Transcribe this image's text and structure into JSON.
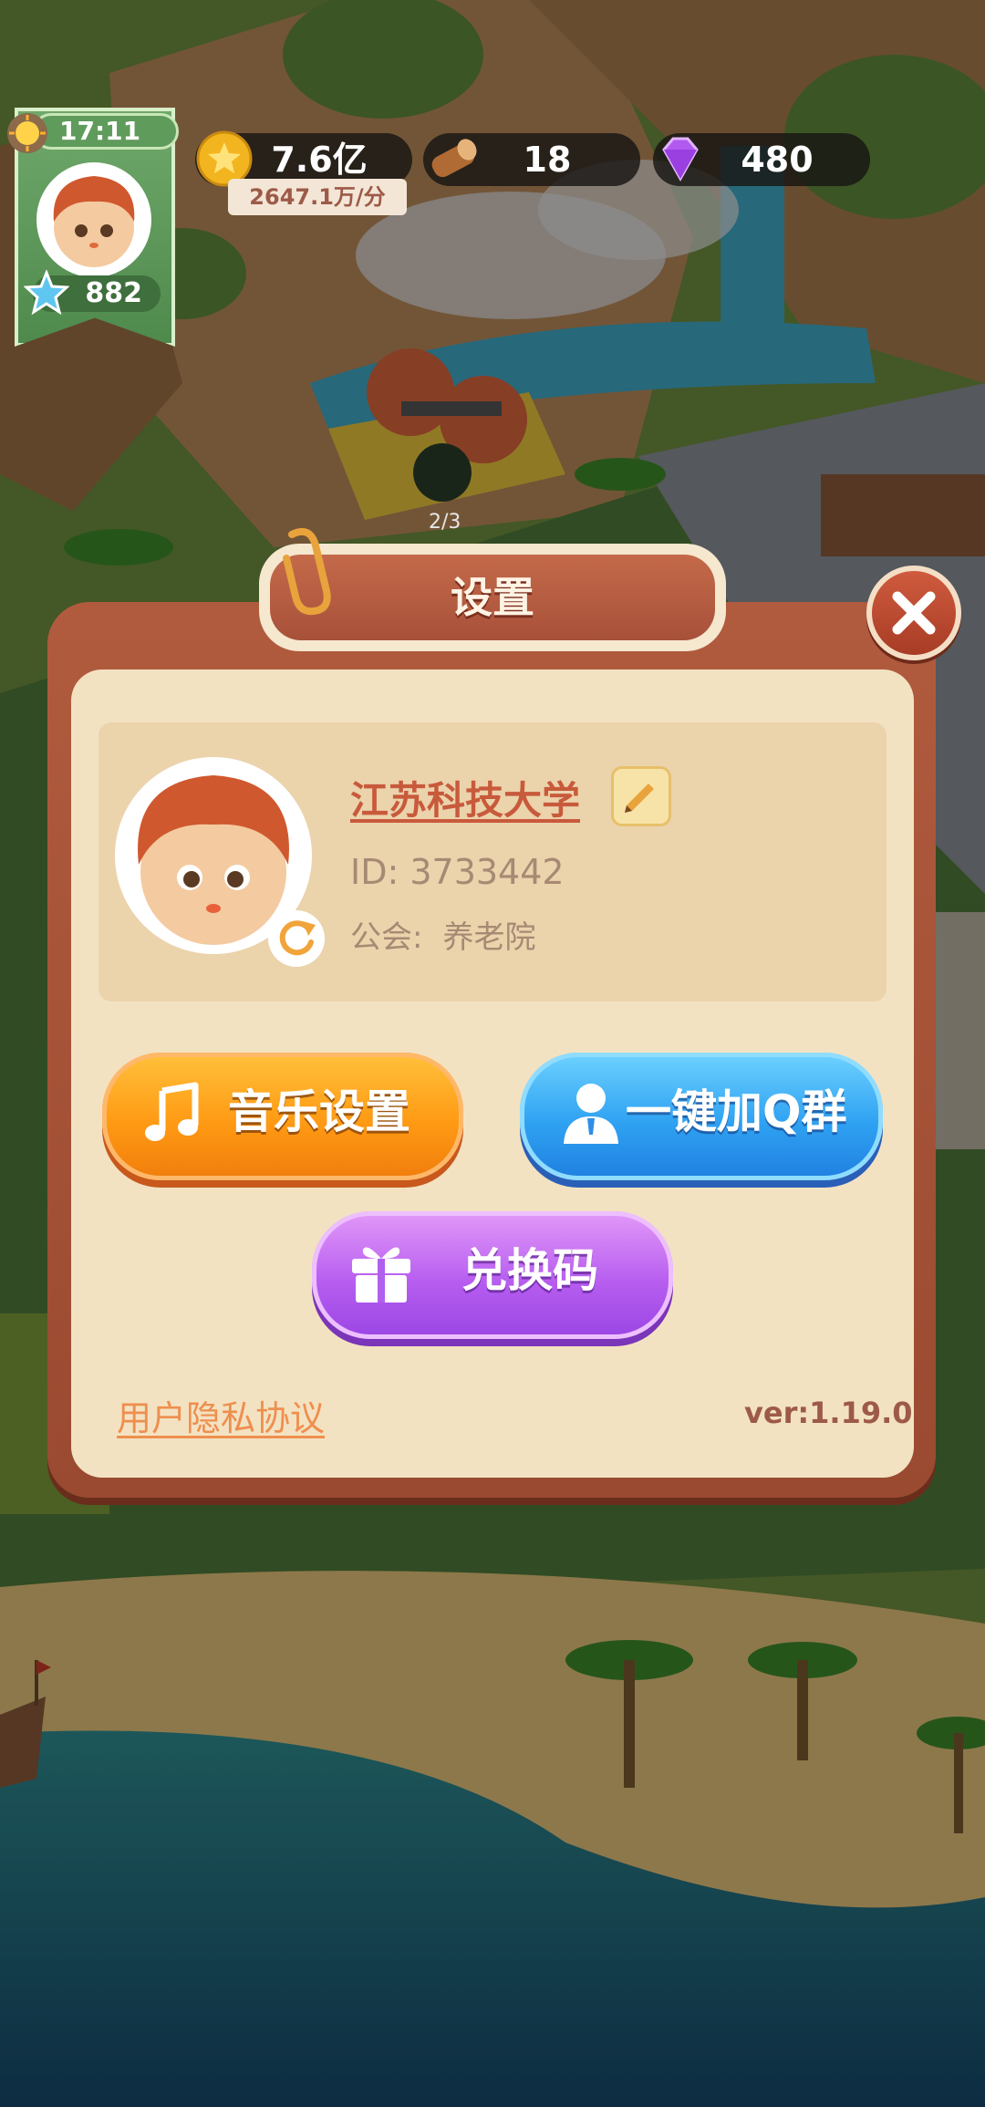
{
  "hud": {
    "time": "17:11",
    "stars": "882",
    "gold": "7.6亿",
    "gold_rate": "2647.1万/分",
    "wood": "18",
    "gems": "480",
    "floor_progress": "2/3"
  },
  "settings_dialog": {
    "title": "设置",
    "profile": {
      "name": "江苏科技大学",
      "id_text": "ID: 3733442",
      "guild_label": "公会:",
      "guild_name": "养老院"
    },
    "buttons": {
      "music": "音乐设置",
      "join_qq": "一键加Q群",
      "redeem": "兑换码"
    },
    "privacy_link": "用户隐私协议",
    "version": "ver:1.19.0"
  },
  "colors": {
    "dialog_frame": "#a8513a",
    "dialog_body": "#f3e2c2",
    "music_button": "#ff9a14",
    "qq_button": "#2fa2f2",
    "redeem_button": "#b75ef0",
    "link": "#ee8f4e"
  },
  "icons": {
    "close": "close-icon",
    "edit": "pencil-icon",
    "refresh": "refresh-icon",
    "music": "music-note-icon",
    "qq": "person-icon",
    "redeem": "gift-icon"
  }
}
